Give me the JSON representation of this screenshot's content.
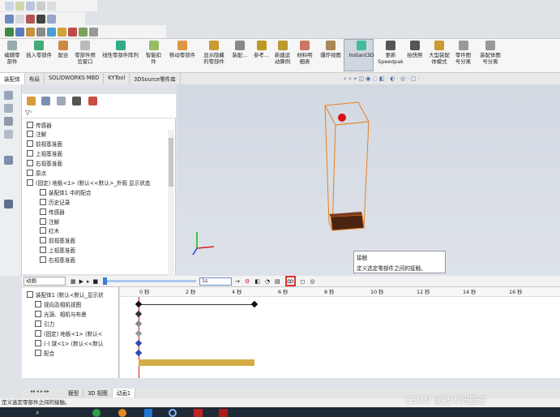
{
  "command_manager": {
    "buttons": [
      {
        "label": "编辑零\n部件",
        "key": "edit-component"
      },
      {
        "label": "插入零部件",
        "key": "insert-components"
      },
      {
        "label": "配合",
        "key": "mate"
      },
      {
        "label": "零部件预\n览窗口",
        "key": "component-preview"
      },
      {
        "label": "线性零部件阵列",
        "key": "linear-pattern"
      },
      {
        "label": "智能扣\n件",
        "key": "smart-fasteners"
      },
      {
        "label": "移动零部件",
        "key": "move-component"
      },
      {
        "label": "显示隐藏\n的零部件",
        "key": "show-hidden"
      },
      {
        "label": "装配...",
        "key": "assembly-features"
      },
      {
        "label": "参考...",
        "key": "reference-geometry"
      },
      {
        "label": "新建运\n动算例",
        "key": "new-motion-study"
      },
      {
        "label": "材料明\n细表",
        "key": "bill-of-materials"
      },
      {
        "label": "爆炸视图",
        "key": "exploded-view"
      },
      {
        "label": "Instant3D",
        "key": "instant3d"
      },
      {
        "label": "更新\nSpeedpak",
        "key": "update-speedpak"
      },
      {
        "label": "拍快照",
        "key": "take-snapshot"
      },
      {
        "label": "大型装配\n体模式",
        "key": "large-assembly-mode"
      },
      {
        "label": "零件图\n号分离",
        "key": "part-number-split"
      },
      {
        "label": "装配体图\n号分离",
        "key": "assembly-number-split"
      }
    ]
  },
  "tabs": [
    "装配体",
    "布局",
    "SOLIDWORKS MBD",
    "KYTool",
    "3DSource零件库"
  ],
  "feature_tree": {
    "items": [
      {
        "label": "传感器",
        "indent": 0
      },
      {
        "label": "注解",
        "indent": 0
      },
      {
        "label": "前视基准面",
        "indent": 0
      },
      {
        "label": "上视基准面",
        "indent": 0
      },
      {
        "label": "右视基准面",
        "indent": 0
      },
      {
        "label": "原点",
        "indent": 0
      },
      {
        "label": "(固定) 地板<1> (默认<<默认>_外观 显示状态",
        "indent": 0
      },
      {
        "label": "装配体1 中的配合",
        "indent": 1
      },
      {
        "label": "历史记录",
        "indent": 1
      },
      {
        "label": "传感器",
        "indent": 1
      },
      {
        "label": "注解",
        "indent": 1
      },
      {
        "label": "红木",
        "indent": 1
      },
      {
        "label": "前视基准面",
        "indent": 1
      },
      {
        "label": "上视基准面",
        "indent": 1
      },
      {
        "label": "右视基准面",
        "indent": 1
      }
    ]
  },
  "tooltip": {
    "title": "接触",
    "text": "定义选定零部件之间的接触。"
  },
  "motion": {
    "study_type": "动画",
    "time_value": "1s",
    "tree_items": [
      "装配体1 (默认<默认_显示状",
      "视向及相机视图",
      "光源、相机与布景",
      "引力",
      "(固定) 地板<1> (默认<",
      "(-) 球<1> (默认<<默认",
      "配合"
    ],
    "ticks": [
      "0 秒",
      "2 秒",
      "4 秒",
      "6 秒",
      "8 秒",
      "10 秒",
      "12 秒",
      "14 秒",
      "16 秒"
    ]
  },
  "bottom_tabs": [
    "模型",
    "3D 视图",
    "动画1"
  ],
  "status_text": "定义选定零部件之间的接触。",
  "watermark": "CSDN @技术死肥仔"
}
